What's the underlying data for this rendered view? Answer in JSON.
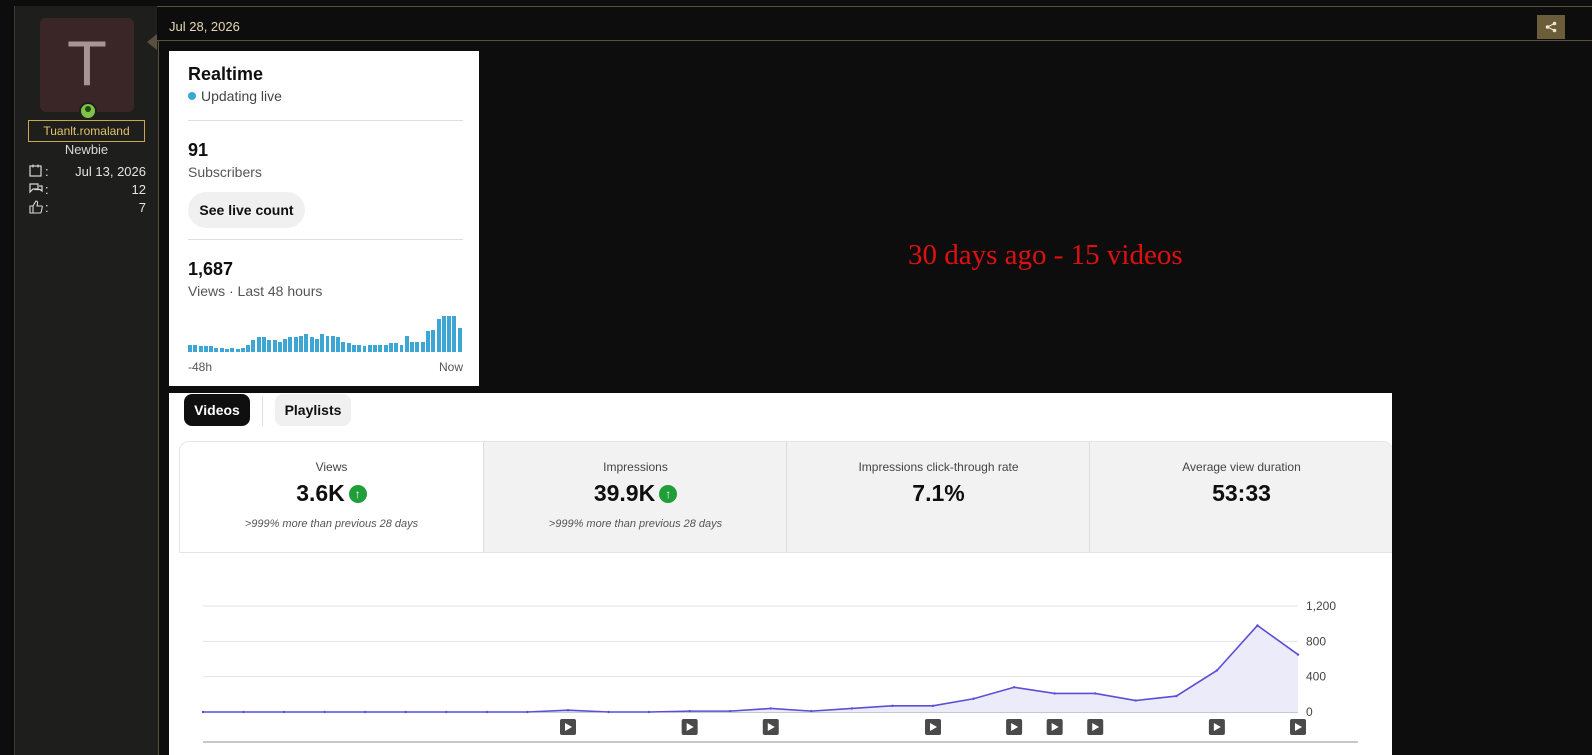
{
  "user": {
    "avatar_letter": "T",
    "username": "Tuanlt.romaland",
    "title": "Newbie",
    "stats": [
      {
        "icon": "calendar-icon",
        "value": "Jul 13, 2026"
      },
      {
        "icon": "messages-icon",
        "value": "12"
      },
      {
        "icon": "thumbs-up-icon",
        "value": "7"
      }
    ]
  },
  "post": {
    "date": "Jul 28, 2026",
    "caption": "30 days ago - 15 videos"
  },
  "realtime": {
    "title": "Realtime",
    "live": "Updating live",
    "subscribers": "91",
    "subscribers_label": "Subscribers",
    "live_count_button": "See live count",
    "views": "1,687",
    "views_label": "Views · Last 48 hours",
    "axis_start": "-48h",
    "axis_end": "Now",
    "hourly_views": [
      5,
      5,
      4,
      4,
      4,
      3,
      3,
      2,
      3,
      2,
      3,
      5,
      8,
      10,
      10,
      8,
      8,
      7,
      9,
      10,
      10,
      11,
      12,
      10,
      9,
      12,
      11,
      11,
      10,
      7,
      6,
      5,
      5,
      4,
      5,
      5,
      5,
      5,
      6,
      6,
      5,
      11,
      7,
      7,
      7,
      14,
      15,
      22,
      24,
      24,
      24,
      16
    ]
  },
  "analytics": {
    "tabs": [
      "Videos",
      "Playlists"
    ],
    "metrics": [
      {
        "label": "Views",
        "value": "3.6K",
        "trend": "up",
        "sub": ">999% more than previous 28 days"
      },
      {
        "label": "Impressions",
        "value": "39.9K",
        "trend": "up",
        "sub": ">999% more than previous 28 days"
      },
      {
        "label": "Impressions click-through rate",
        "value": "7.1%",
        "trend": "",
        "sub": ""
      },
      {
        "label": "Average view duration",
        "value": "53:33",
        "trend": "",
        "sub": ""
      }
    ]
  },
  "chart_data": {
    "type": "area",
    "x": [
      1,
      2,
      3,
      4,
      5,
      6,
      7,
      8,
      9,
      10,
      11,
      12,
      13,
      14,
      15,
      16,
      17,
      18,
      19,
      20,
      21,
      22,
      23,
      24,
      25,
      26,
      27,
      28
    ],
    "series": [
      {
        "values": [
          0,
          0,
          0,
          0,
          0,
          0,
          0,
          0,
          0,
          20,
          0,
          0,
          10,
          10,
          40,
          10,
          40,
          70,
          70,
          150,
          280,
          210,
          210,
          130,
          180,
          470,
          980,
          650
        ]
      }
    ],
    "ylim": [
      0,
      1200
    ],
    "yticks": [
      "1,200",
      "800",
      "400",
      "0"
    ],
    "video_markers": [
      10,
      13,
      15,
      19,
      21,
      22,
      23,
      26,
      28
    ],
    "grid": true,
    "colors": {
      "line": "#5a4fd6",
      "fill": "#ecebfa"
    }
  }
}
